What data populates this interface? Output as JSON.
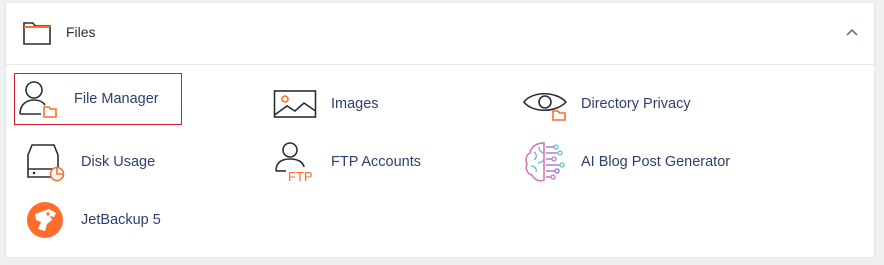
{
  "section": {
    "title": "Files",
    "icon": "folder-icon",
    "collapse_icon": "chevron-up-icon"
  },
  "items": [
    {
      "label": "File Manager",
      "icon": "user-folder-icon",
      "selected": true
    },
    {
      "label": "Images",
      "icon": "image-icon",
      "selected": false
    },
    {
      "label": "Directory Privacy",
      "icon": "eye-folder-icon",
      "selected": false
    },
    {
      "label": "Disk Usage",
      "icon": "disk-chart-icon",
      "selected": false
    },
    {
      "label": "FTP Accounts",
      "icon": "user-ftp-icon",
      "selected": false
    },
    {
      "label": "AI Blog Post Generator",
      "icon": "ai-brain-icon",
      "selected": false
    },
    {
      "label": "JetBackup 5",
      "icon": "jetbackup-logo-icon",
      "selected": false
    }
  ],
  "ftp_badge": "FTP",
  "colors": {
    "accent": "#ff6c2c",
    "link": "#2e3f6e",
    "selected_border": "#d21f2c"
  }
}
